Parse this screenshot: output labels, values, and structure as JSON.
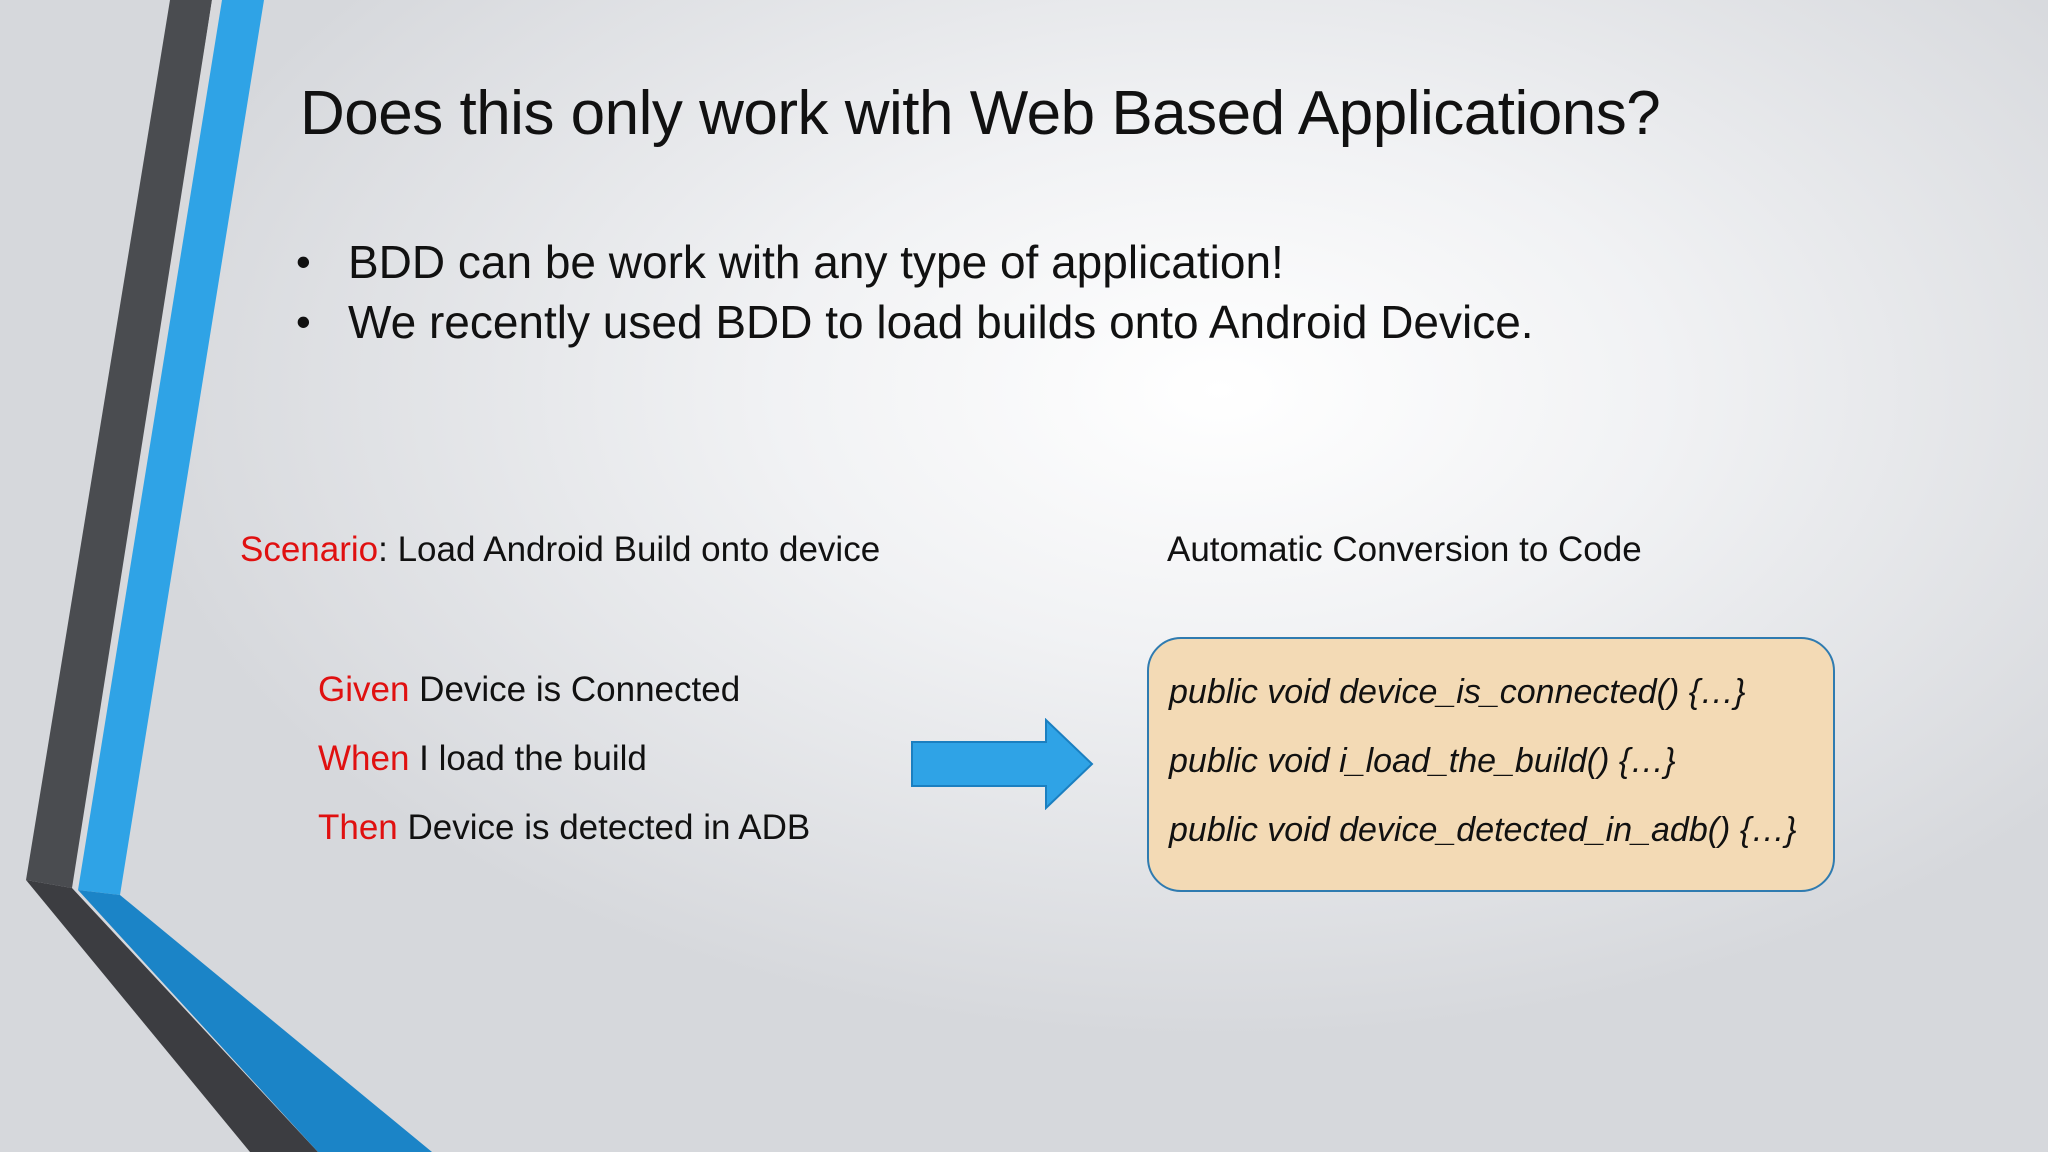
{
  "slide": {
    "title": "Does this only work with Web Based Applications?",
    "bullets": [
      "BDD can be work with any type of application!",
      "We recently used BDD to load builds onto Android Device."
    ]
  },
  "scenario": {
    "keyword": "Scenario",
    "text": ": Load Android Build onto device",
    "steps": [
      {
        "keyword": "Given",
        "text": " Device is Connected"
      },
      {
        "keyword": "When",
        "text": " I load the build"
      },
      {
        "keyword": "Then",
        "text": " Device is detected in ADB"
      }
    ]
  },
  "conversion": {
    "label": "Automatic Conversion to Code",
    "code_lines": [
      "public void device_is_connected() {…}",
      "public void i_load_the_build() {…}",
      "public void device_detected_in_adb() {…}"
    ]
  },
  "colors": {
    "keyword_red": "#e01010",
    "accent_blue": "#2fa3e6",
    "dark_bar": "#4a4c50",
    "code_box_fill": "#f3dab5",
    "code_box_border": "#2f7bb0"
  }
}
